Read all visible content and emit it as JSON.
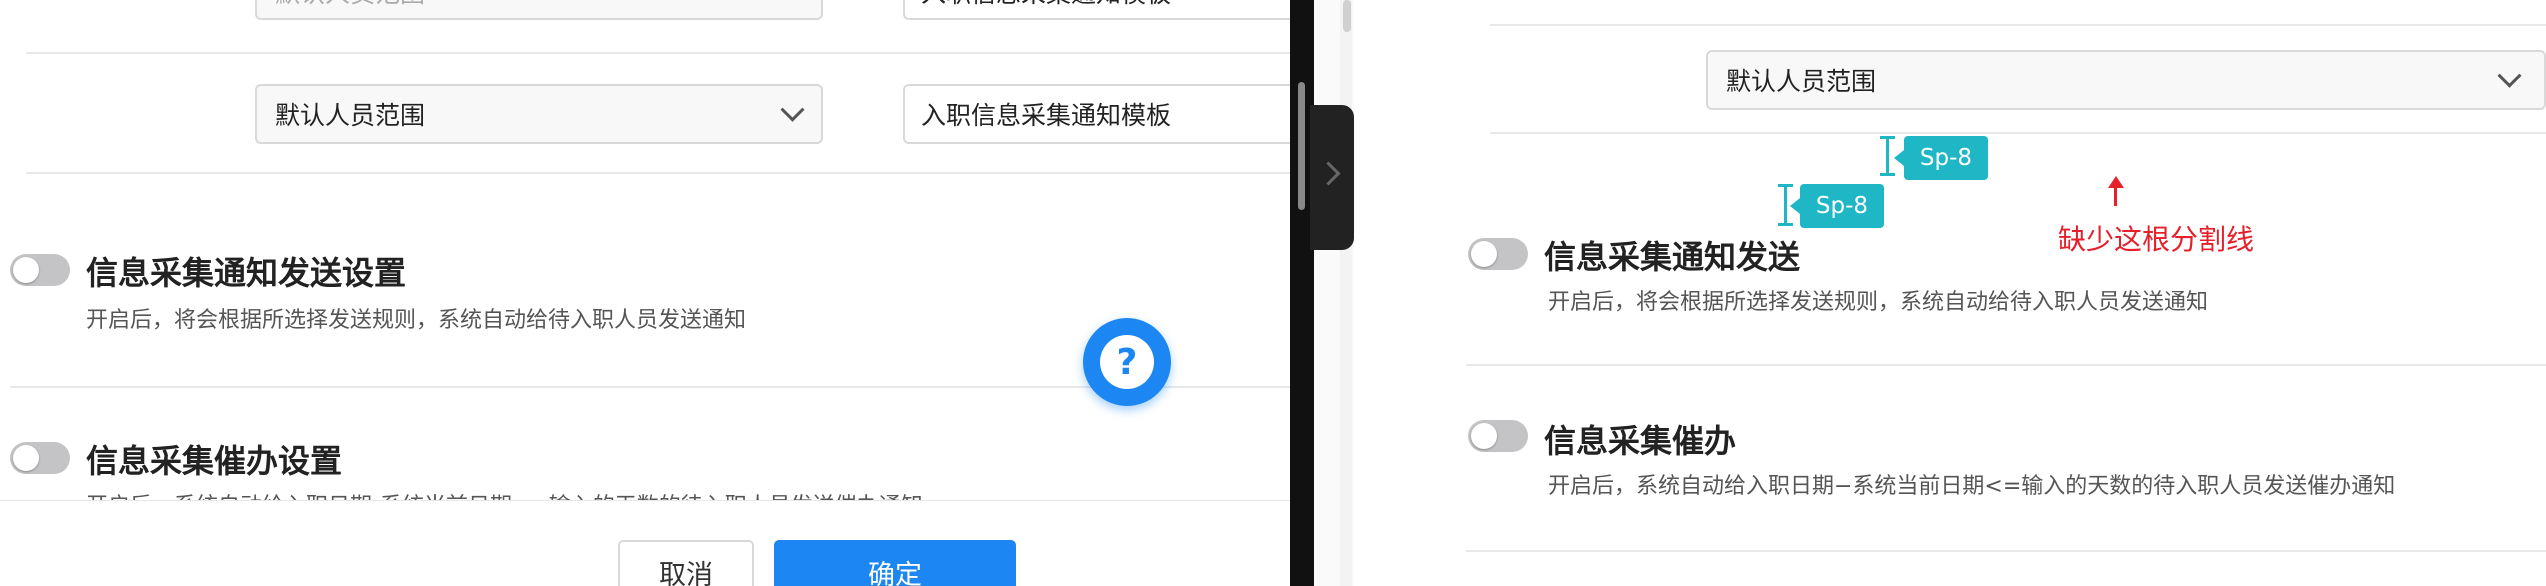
{
  "left": {
    "row1_select": "默认人员范围",
    "row1_input": "入职信息采集通知模板",
    "row2_select": "默认人员范围",
    "row2_input": "入职信息采集通知模板",
    "section1": {
      "title": "信息采集通知发送设置",
      "desc": "开启后，将会根据所选择发送规则，系统自动给待入职人员发送通知"
    },
    "section2": {
      "title": "信息采集催办设置",
      "desc": "开启后，系统自动给入职日期-系统当前日期<=输入的天数的待入职人员发送催办通知"
    },
    "help_icon": "?",
    "cancel_label": "取消",
    "confirm_label": "确定"
  },
  "right": {
    "select": "默认人员范围",
    "spacing_tags": [
      "Sp-8",
      "Sp-8"
    ],
    "annotation": "缺少这根分割线",
    "section1": {
      "title": "信息采集通知发送",
      "desc": "开启后，将会根据所选择发送规则，系统自动给待入职人员发送通知"
    },
    "section2": {
      "title": "信息采集催办",
      "desc": "开启后，系统自动给入职日期−系统当前日期<=输入的天数的待入职人员发送催办通知"
    }
  },
  "colors": {
    "primary": "#1c86f2",
    "spacing_tag": "#1fb7c6",
    "annotation_red": "#e5202b"
  }
}
